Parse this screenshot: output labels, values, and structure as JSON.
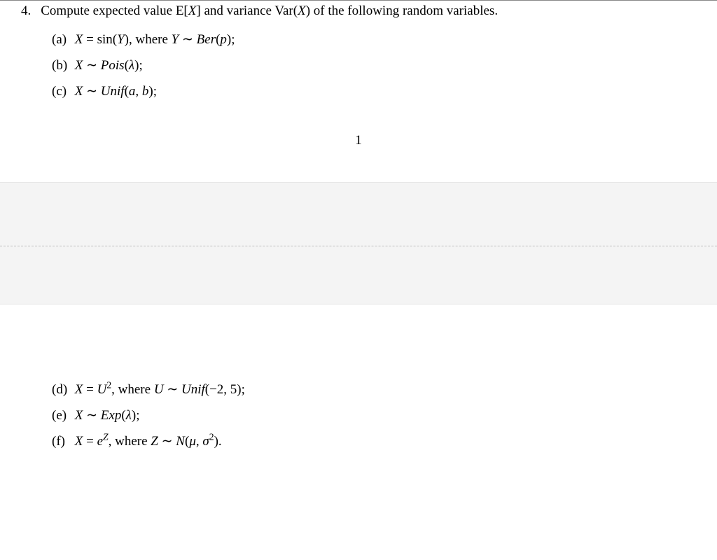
{
  "problem": {
    "number": "4.",
    "prompt": "Compute expected value E[X] and variance Var(X) of the following random variables."
  },
  "items_top": [
    {
      "label": "(a)",
      "body": "X = sin(Y), where Y ∼ Ber(p);"
    },
    {
      "label": "(b)",
      "body": "X ∼ Pois(λ);"
    },
    {
      "label": "(c)",
      "body": "X ∼ Unif(a, b);"
    }
  ],
  "page_number": "1",
  "items_bottom": [
    {
      "label": "(d)",
      "body_html": "X = U<span class=\"sup\">2</span>, where U ∼ Unif(−2, 5);"
    },
    {
      "label": "(e)",
      "body_html": "X ∼ Exp(λ);"
    },
    {
      "label": "(f)",
      "body_html": "X = e<span class=\"sup\">Z</span>, where Z ∼ N(μ, σ<span class=\"sup\">2</span>)."
    }
  ]
}
